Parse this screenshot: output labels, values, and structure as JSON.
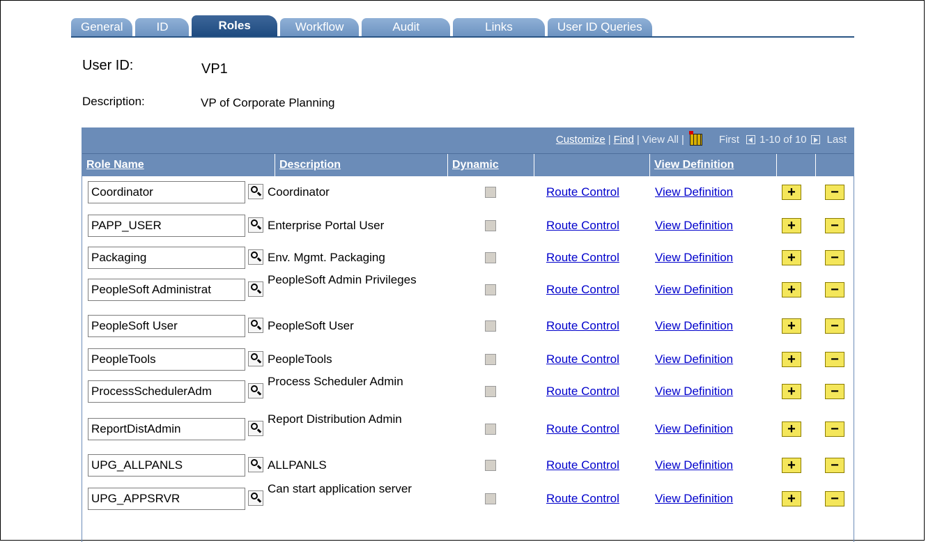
{
  "tabs": [
    {
      "label": "General",
      "active": false
    },
    {
      "label": "ID",
      "active": false
    },
    {
      "label": "Roles",
      "active": true
    },
    {
      "label": "Workflow",
      "active": false
    },
    {
      "label": "Audit",
      "active": false
    },
    {
      "label": "Links",
      "active": false
    },
    {
      "label": "User ID Queries",
      "active": false
    }
  ],
  "user_id": {
    "label": "User ID:",
    "value": "VP1"
  },
  "description": {
    "label": "Description:",
    "value": "VP of Corporate Planning"
  },
  "grid": {
    "nav": {
      "customize": "Customize",
      "sep1": "|",
      "find": "Find",
      "sep2": "|",
      "view_all": "View All",
      "sep3": "|",
      "first": "First",
      "range": "1-10 of 10",
      "last": "Last"
    },
    "columns": {
      "role_name": "Role Name",
      "description": "Description",
      "dynamic": "Dynamic",
      "view_definition": "View Definition"
    },
    "rows": [
      {
        "role": "Coordinator",
        "desc": "Coordinator",
        "route": "Route Control",
        "view": "View Definition",
        "add": "+",
        "remove": "−"
      },
      {
        "role": "PAPP_USER",
        "desc": "Enterprise Portal User",
        "route": "Route Control",
        "view": "View Definition",
        "add": "+",
        "remove": "−"
      },
      {
        "role": "Packaging",
        "desc": "Env. Mgmt. Packaging",
        "route": "Route Control",
        "view": "View Definition",
        "add": "+",
        "remove": "−"
      },
      {
        "role": "PeopleSoft Administrat",
        "desc": "PeopleSoft Admin Privileges",
        "route": "Route Control",
        "view": "View Definition",
        "add": "+",
        "remove": "−"
      },
      {
        "role": "PeopleSoft User",
        "desc": "PeopleSoft User",
        "route": "Route Control",
        "view": "View Definition",
        "add": "+",
        "remove": "−"
      },
      {
        "role": "PeopleTools",
        "desc": "PeopleTools",
        "route": "Route Control",
        "view": "View Definition",
        "add": "+",
        "remove": "−"
      },
      {
        "role": "ProcessSchedulerAdm",
        "desc": "Process Scheduler Admin",
        "route": "Route Control",
        "view": "View Definition",
        "add": "+",
        "remove": "−"
      },
      {
        "role": "ReportDistAdmin",
        "desc": "Report Distribution Admin",
        "route": "Route Control",
        "view": "View Definition",
        "add": "+",
        "remove": "−"
      },
      {
        "role": "UPG_ALLPANLS",
        "desc": "ALLPANLS",
        "route": "Route Control",
        "view": "View Definition",
        "add": "+",
        "remove": "−"
      },
      {
        "role": "UPG_APPSRVR",
        "desc": "Can start application server",
        "route": "Route Control",
        "view": "View Definition",
        "add": "+",
        "remove": "−"
      }
    ]
  },
  "colors": {
    "tab": "#6d93c1",
    "tab_active": "#1e4b80",
    "grid_header": "#6b8cb8",
    "link": "#0000cc",
    "button": "#f4e65a"
  }
}
